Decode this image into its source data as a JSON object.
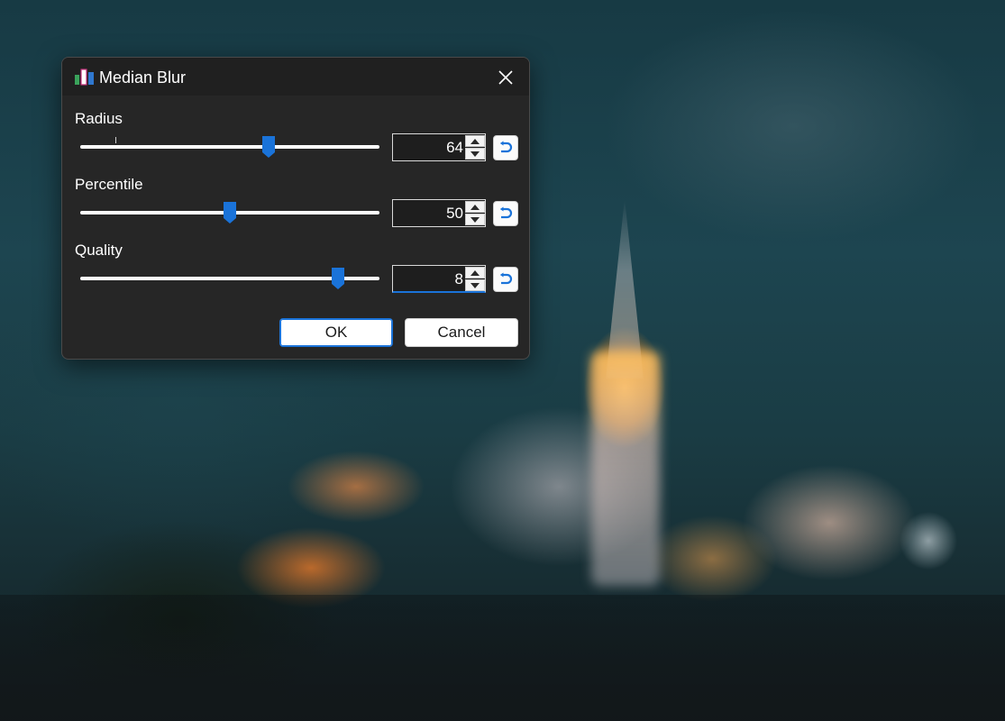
{
  "dialog": {
    "title": "Median Blur",
    "app_icon": "bar-chart-icon",
    "close_icon": "close-icon"
  },
  "fields": [
    {
      "label": "Radius",
      "value": "64",
      "slider_fraction": 0.63
    },
    {
      "label": "Percentile",
      "value": "50",
      "slider_fraction": 0.5
    },
    {
      "label": "Quality",
      "value": "8",
      "slider_fraction": 0.86
    }
  ],
  "buttons": {
    "ok": "OK",
    "cancel": "Cancel"
  },
  "colors": {
    "accent": "#1a73d9",
    "dialog_bg": "#262626",
    "titlebar_bg": "#202020"
  }
}
